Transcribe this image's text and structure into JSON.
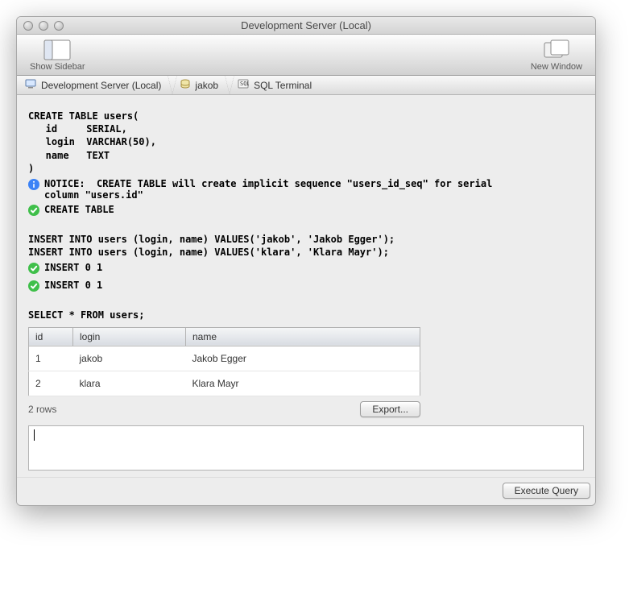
{
  "window": {
    "title": "Development Server (Local)"
  },
  "toolbar": {
    "show_sidebar": "Show Sidebar",
    "new_window": "New Window"
  },
  "breadcrumbs": [
    {
      "icon": "monitor",
      "label": "Development Server (Local)"
    },
    {
      "icon": "database",
      "label": "jakob"
    },
    {
      "icon": "terminal",
      "label": "SQL Terminal"
    }
  ],
  "sql": {
    "create_table": "CREATE TABLE users(\n   id     SERIAL,\n   login  VARCHAR(50),\n   name   TEXT\n)",
    "notice": "NOTICE:  CREATE TABLE will create implicit sequence \"users_id_seq\" for serial\ncolumn \"users.id\"",
    "create_result": "CREATE TABLE",
    "inserts": "INSERT INTO users (login, name) VALUES('jakob', 'Jakob Egger');\nINSERT INTO users (login, name) VALUES('klara', 'Klara Mayr');",
    "insert_result_1": "INSERT 0 1",
    "insert_result_2": "INSERT 0 1",
    "select": "SELECT * FROM users;"
  },
  "table": {
    "headers": [
      "id",
      "login",
      "name"
    ],
    "rows": [
      {
        "id": "1",
        "login": "jakob",
        "name": "Jakob Egger"
      },
      {
        "id": "2",
        "login": "klara",
        "name": "Klara Mayr"
      }
    ],
    "row_count": "2 rows",
    "export": "Export..."
  },
  "editor": {
    "value": ""
  },
  "buttons": {
    "execute": "Execute Query"
  }
}
